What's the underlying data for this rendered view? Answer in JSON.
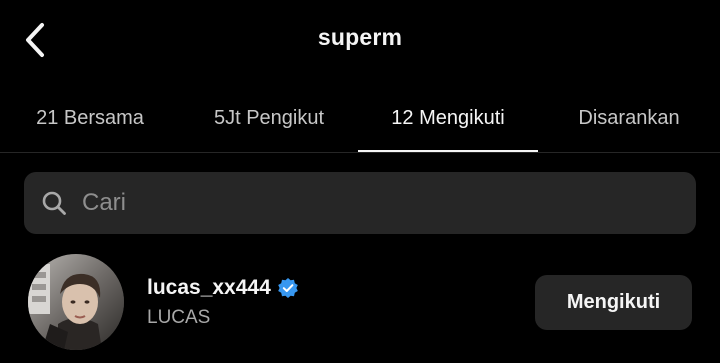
{
  "header": {
    "title": "superm",
    "back_icon": "chevron-left-icon"
  },
  "tabs": [
    {
      "label": "21 Bersama",
      "active": false
    },
    {
      "label": "5Jt Pengikut",
      "active": false
    },
    {
      "label": "12 Mengikuti",
      "active": true
    },
    {
      "label": "Disarankan",
      "active": false
    }
  ],
  "search": {
    "placeholder": "Cari",
    "value": "",
    "icon": "search-icon"
  },
  "users": [
    {
      "username": "lucas_xx444",
      "verified": true,
      "full_name": "LUCAS",
      "button_label": "Mengikuti"
    }
  ],
  "colors": {
    "background": "#000000",
    "surface": "#262626",
    "text_primary": "#f5f5f5",
    "text_secondary": "#a8a8a8",
    "verified_badge": "#3797f0"
  }
}
